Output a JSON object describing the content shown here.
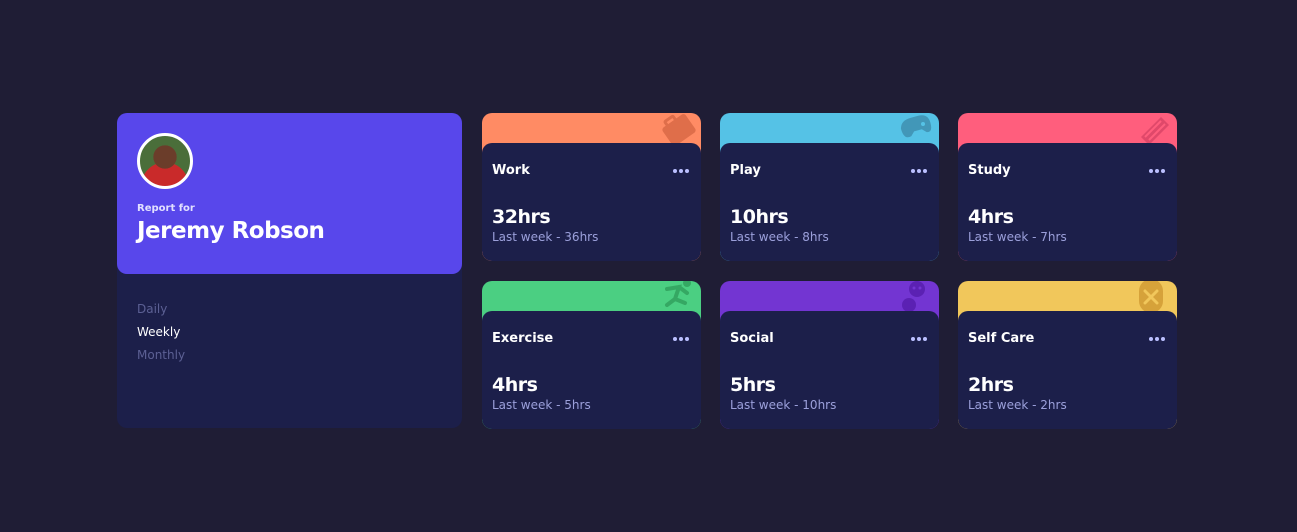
{
  "profile": {
    "report_for": "Report for",
    "name": "Jeremy Robson"
  },
  "periods": [
    "Daily",
    "Weekly",
    "Monthly"
  ],
  "active_period": "Weekly",
  "cards": [
    {
      "title": "Work",
      "hours": "32hrs",
      "previous": "Last week - 36hrs",
      "color": "#ff8b64",
      "icon": "briefcase-icon",
      "icon_color": "#df6e4a"
    },
    {
      "title": "Play",
      "hours": "10hrs",
      "previous": "Last week - 8hrs",
      "color": "#55c2e6",
      "icon": "gamepad-icon",
      "icon_color": "#4297b8"
    },
    {
      "title": "Study",
      "hours": "4hrs",
      "previous": "Last week - 7hrs",
      "color": "#ff5e7d",
      "icon": "book-icon",
      "icon_color": "#e0486a"
    },
    {
      "title": "Exercise",
      "hours": "4hrs",
      "previous": "Last week - 5hrs",
      "color": "#4bcf82",
      "icon": "runner-icon",
      "icon_color": "#35a863"
    },
    {
      "title": "Social",
      "hours": "5hrs",
      "previous": "Last week - 10hrs",
      "color": "#7335d2",
      "icon": "social-icon",
      "icon_color": "#5b21b3"
    },
    {
      "title": "Self Care",
      "hours": "2hrs",
      "previous": "Last week - 2hrs",
      "color": "#f1c75b",
      "icon": "selfcare-icon",
      "icon_color": "#d6a23a"
    }
  ]
}
